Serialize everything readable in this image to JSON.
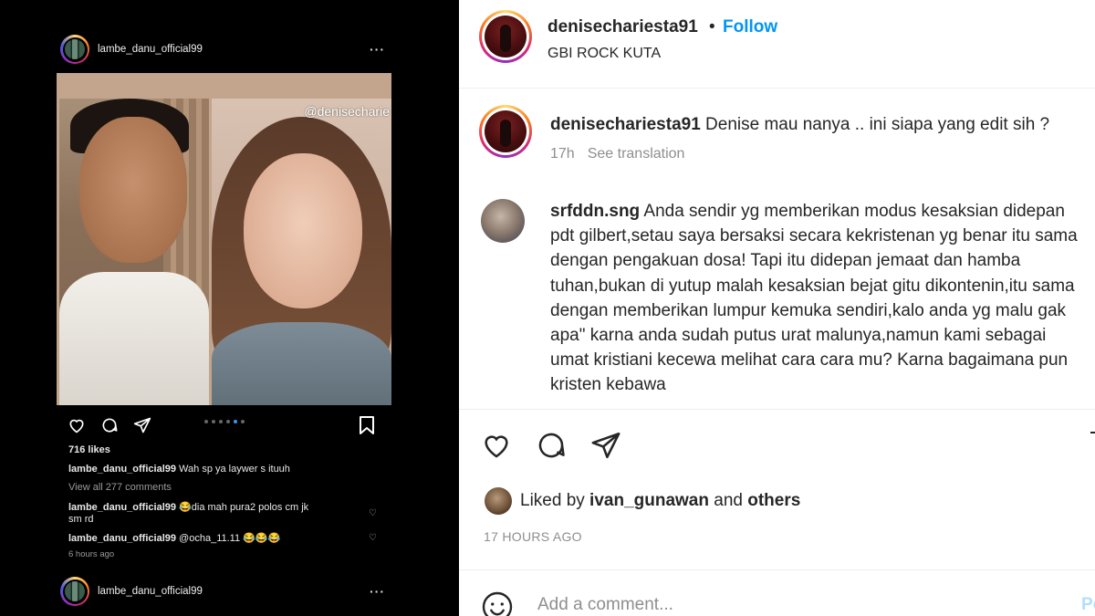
{
  "left_post": {
    "username": "lambe_danu_official99",
    "more_icon": "···",
    "photo_tag": "@denisecharie",
    "likes": "716 likes",
    "caption_user": "lambe_danu_official99",
    "caption_text": " Wah sp ya laywer s ituuh",
    "view_comments": "View all 277 comments",
    "comments": [
      {
        "user": "lambe_danu_official99",
        "text": " 😂dia mah pura2 polos cm jk",
        "text2": "sm rd"
      },
      {
        "user": "lambe_danu_official99",
        "text": " @ocha_11.11 😂😂😂"
      }
    ],
    "time_ago": "6 hours ago",
    "next_post_username": "lambe_danu_official99",
    "carousel_active_index": 4,
    "carousel_count": 6
  },
  "right_post": {
    "username": "denisechariesta91",
    "separator": "•",
    "follow_label": "Follow",
    "location": "GBI ROCK KUTA",
    "caption_user": "denisechariesta91",
    "caption_text": " Denise mau nanya .. ini siapa yang edit sih ?",
    "caption_time": "17h",
    "see_translation": "See translation",
    "comment_user": "srfddn.sng",
    "comment_text": " Anda sendir yg memberikan modus kesaksian didepan pdt gilbert,setau saya bersaksi secara kekristenan yg benar itu sama dengan pengakuan dosa! Tapi itu didepan jemaat dan hamba tuhan,bukan di yutup malah kesaksian bejat gitu dikontenin,itu sama dengan memberikan lumpur kemuka sendiri,kalo anda yg malu gak apa\" karna anda sudah putus urat malunya,namun kami sebagai umat kristiani kecewa melihat cara cara mu? Karna bagaimana pun kristen kebawa",
    "liked_prefix": "Liked by ",
    "liked_user": "ivan_gunawan",
    "liked_and": " and ",
    "liked_others": "others",
    "timestamp": "17 HOURS AGO",
    "add_comment_placeholder": "Add a comment...",
    "post_label": "Post",
    "accent_color": "#0095f6"
  }
}
